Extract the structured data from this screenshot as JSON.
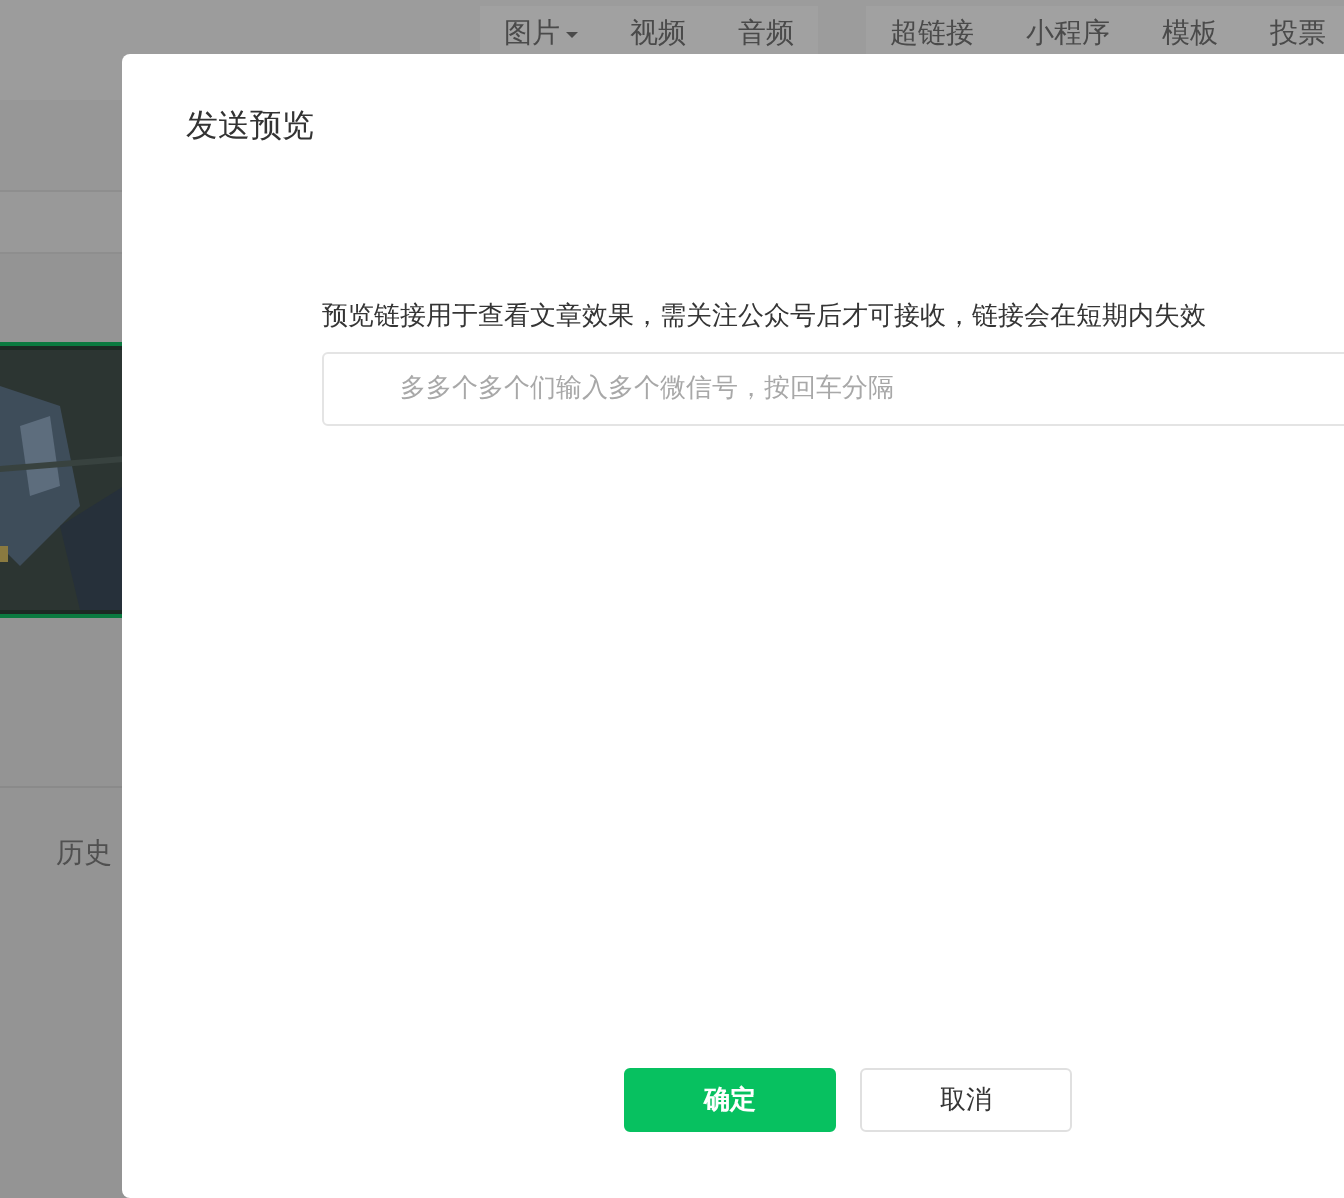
{
  "background": {
    "toolbar_groups": [
      {
        "items": [
          {
            "label": "图片",
            "dropdown": true
          },
          {
            "label": "视频",
            "dropdown": false
          },
          {
            "label": "音频",
            "dropdown": false
          }
        ]
      },
      {
        "items": [
          {
            "label": "超链接",
            "dropdown": false
          },
          {
            "label": "小程序",
            "dropdown": false
          },
          {
            "label": "模板",
            "dropdown": false
          },
          {
            "label": "投票",
            "dropdown": false
          }
        ]
      }
    ],
    "history_label": "历史"
  },
  "dialog": {
    "title": "发送预览",
    "description": "预览链接用于查看文章效果，需关注公众号后才可接收，链接会在短期内失效",
    "input": {
      "placeholder": "多多个多个们输入多个微信号，按回车分隔"
    },
    "buttons": [
      {
        "label": "确定",
        "kind": "primary"
      },
      {
        "label": "取消",
        "kind": "default"
      }
    ]
  }
}
